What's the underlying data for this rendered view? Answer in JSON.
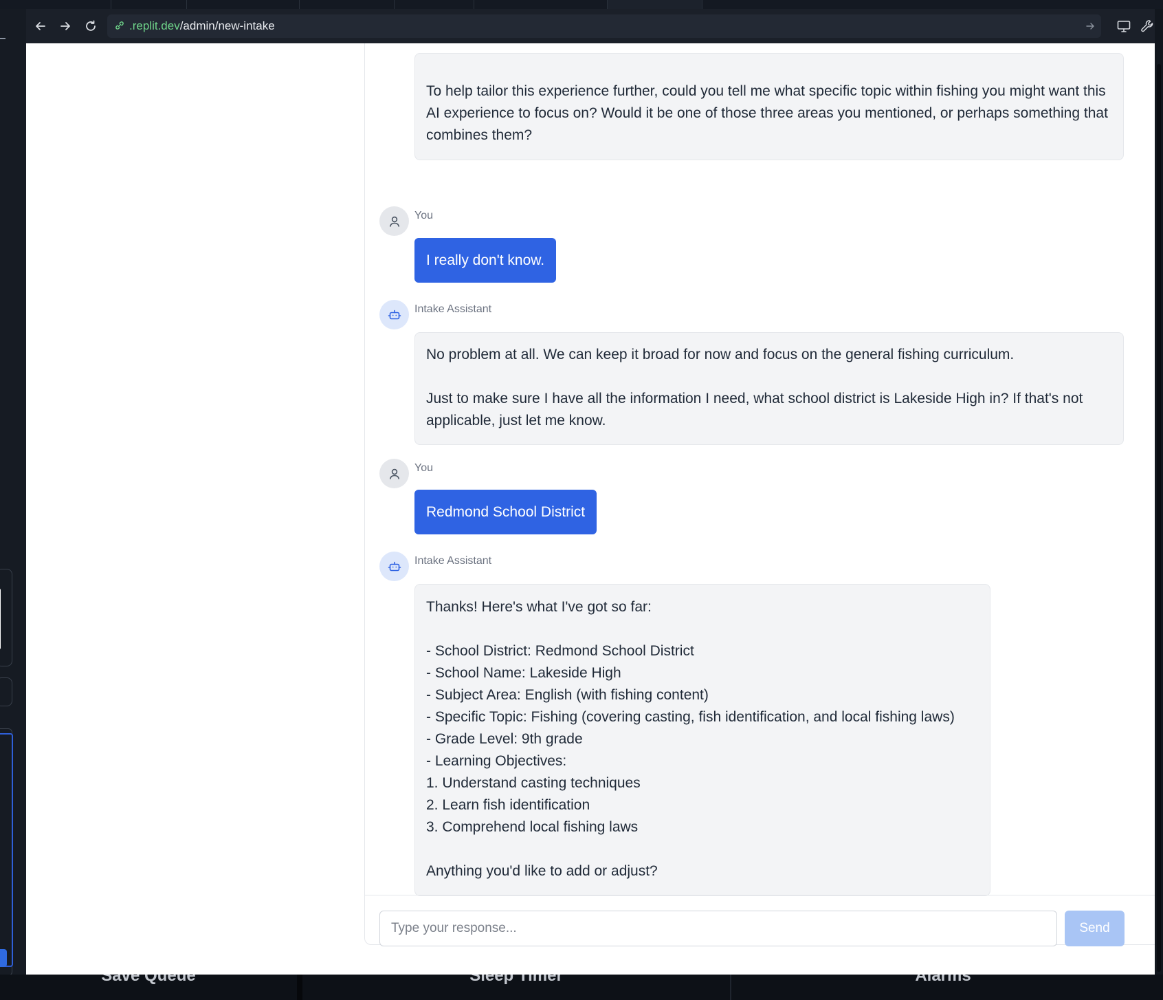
{
  "browser": {
    "url_host": ".replit.dev",
    "url_path": "/admin/new-intake"
  },
  "chat": {
    "messages": [
      {
        "role": "assistant",
        "text": "To help tailor this experience further, could you tell me what specific topic within fishing you might want this AI experience to focus on? Would it be one of those three areas you mentioned, or perhaps something that combines them?"
      },
      {
        "role": "user",
        "sender": "You",
        "text": "I really don't know."
      },
      {
        "role": "assistant",
        "sender": "Intake Assistant",
        "text": "No problem at all. We can keep it broad for now and focus on the general fishing curriculum.\n\nJust to make sure I have all the information I need, what school district is Lakeside High in? If that's not applicable, just let me know."
      },
      {
        "role": "user",
        "sender": "You",
        "text": "Redmond School District"
      },
      {
        "role": "assistant",
        "sender": "Intake Assistant",
        "text": "Thanks! Here's what I've got so far:\n\n- School District: Redmond School District\n- School Name: Lakeside High\n- Subject Area: English (with fishing content)\n- Specific Topic: Fishing (covering casting, fish identification, and local fishing laws)\n- Grade Level: 9th grade\n- Learning Objectives:\n  1. Understand casting techniques\n  2. Learn fish identification\n  3. Comprehend local fishing laws\n\nAnything you'd like to add or adjust?"
      }
    ]
  },
  "composer": {
    "placeholder": "Type your response...",
    "send_label": "Send"
  },
  "bottom_tabs": [
    "Save Queue",
    "Sleep Timer",
    "Alarms"
  ],
  "colors": {
    "user_bubble": "#2f63e3",
    "send_disabled": "#a9c5f5",
    "url_host": "#6fd48a"
  }
}
